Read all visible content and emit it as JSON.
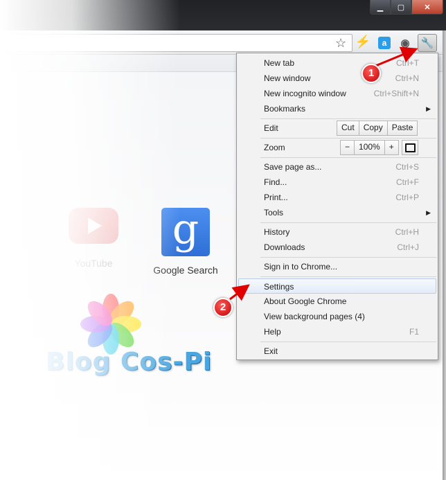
{
  "toolbar": {
    "icons": [
      "star-icon",
      "flash-icon",
      "a-icon",
      "eye-icon",
      "wrench-icon"
    ],
    "ext_a_label": "a"
  },
  "apps": [
    {
      "name": "YouTube"
    },
    {
      "name": "Google Search"
    }
  ],
  "google_icon_glyph": "g",
  "blog_logo_text": "Blog Cos-Pi",
  "menu": {
    "items": {
      "new_tab": {
        "label": "New tab",
        "shortcut": "Ctrl+T"
      },
      "new_window": {
        "label": "New window",
        "shortcut": "Ctrl+N"
      },
      "new_incognito": {
        "label": "New incognito window",
        "shortcut": "Ctrl+Shift+N"
      },
      "bookmarks": {
        "label": "Bookmarks"
      },
      "edit": {
        "label": "Edit",
        "cut": "Cut",
        "copy": "Copy",
        "paste": "Paste"
      },
      "zoom": {
        "label": "Zoom",
        "minus": "−",
        "value": "100%",
        "plus": "+"
      },
      "save_page": {
        "label": "Save page as...",
        "shortcut": "Ctrl+S"
      },
      "find": {
        "label": "Find...",
        "shortcut": "Ctrl+F"
      },
      "print": {
        "label": "Print...",
        "shortcut": "Ctrl+P"
      },
      "tools": {
        "label": "Tools"
      },
      "history": {
        "label": "History",
        "shortcut": "Ctrl+H"
      },
      "downloads": {
        "label": "Downloads",
        "shortcut": "Ctrl+J"
      },
      "sign_in": {
        "label": "Sign in to Chrome..."
      },
      "settings": {
        "label": "Settings"
      },
      "about": {
        "label": "About Google Chrome"
      },
      "background_pages": {
        "label": "View background pages (4)"
      },
      "help": {
        "label": "Help",
        "shortcut": "F1"
      },
      "exit": {
        "label": "Exit"
      }
    }
  },
  "annotations": {
    "step1": "1",
    "step2": "2",
    "color": "#e00000"
  },
  "colors": {
    "menu_highlight": "#e3ecf8",
    "google_blue": "#2f6fd6",
    "youtube_red": "#e98a8a",
    "close_button": "#b93e2a"
  }
}
